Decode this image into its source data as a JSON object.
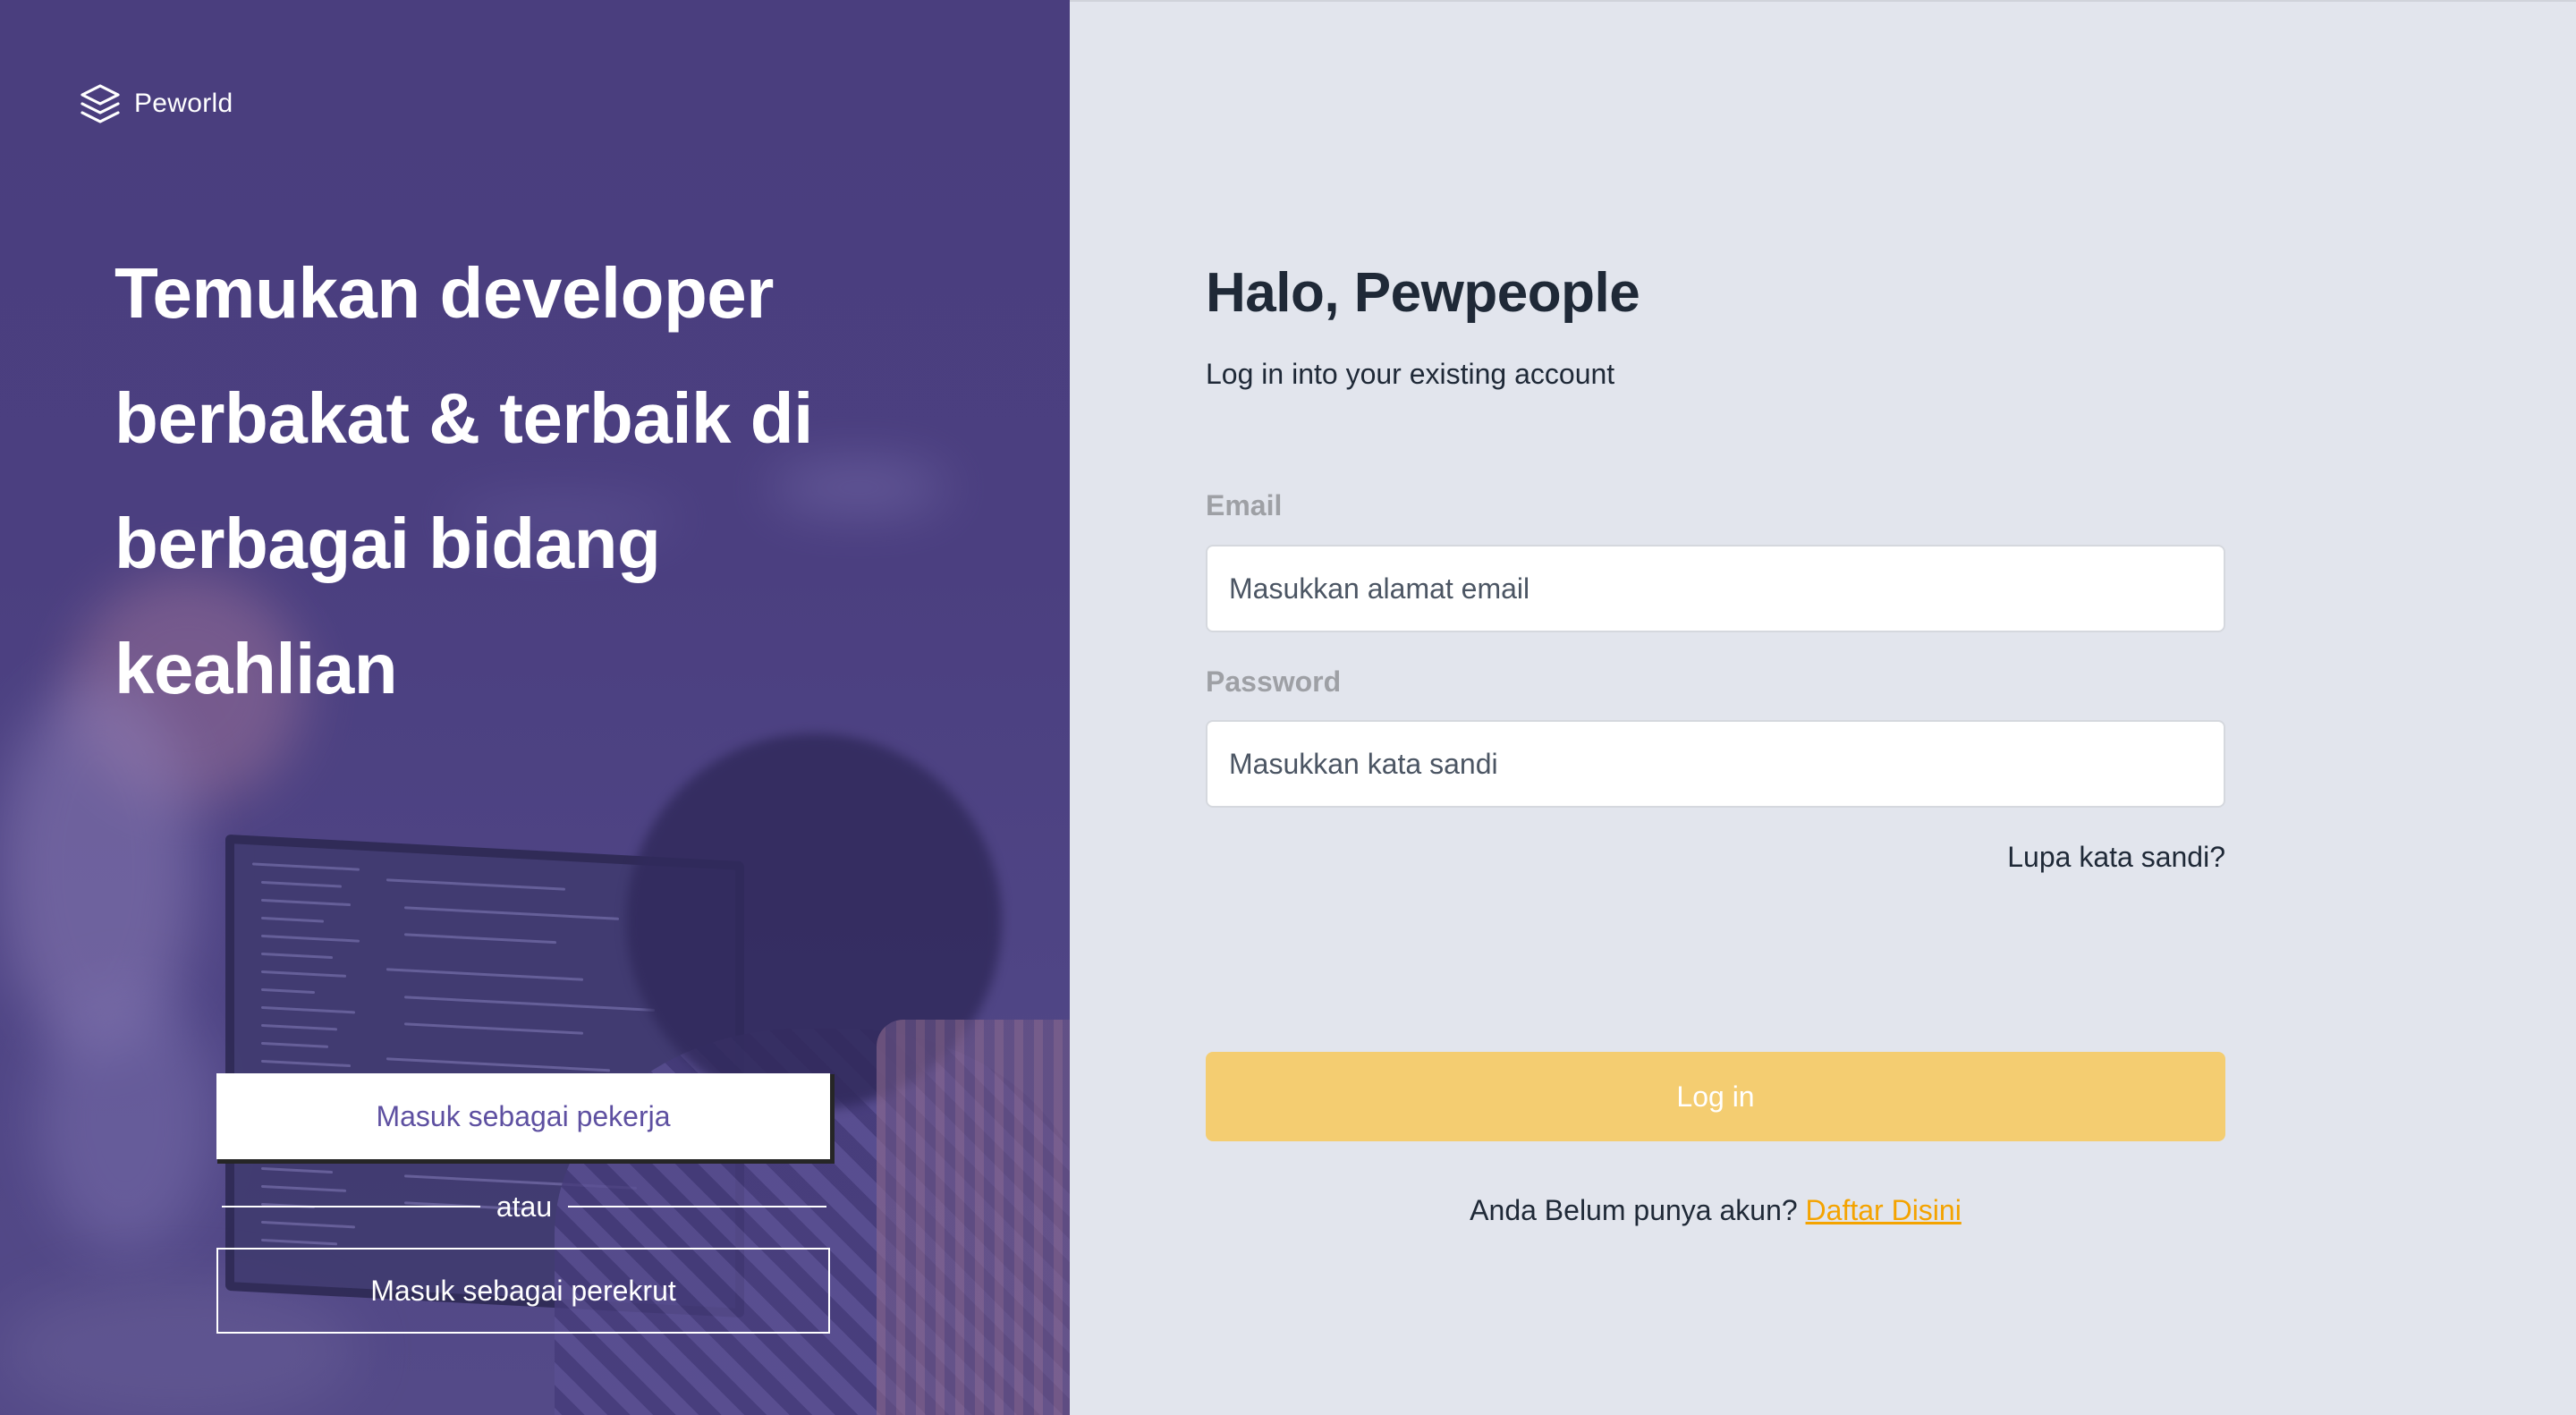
{
  "brand": {
    "name": "Peworld",
    "logo_icon": "layers-icon"
  },
  "hero": {
    "headline": "Temukan developer berbakat & terbaik di berbagai bidang keahlian",
    "worker_button": "Masuk sebagai pekerja",
    "divider_text": "atau",
    "recruiter_button": "Masuk sebagai perekrut"
  },
  "login": {
    "title": "Halo, Pewpeople",
    "subtitle": "Log in into your existing account",
    "email_label": "Email",
    "email_placeholder": "Masukkan alamat email",
    "email_value": "",
    "password_label": "Password",
    "password_placeholder": "Masukkan kata sandi",
    "password_value": "",
    "forgot_link": "Lupa kata sandi?",
    "submit_label": "Log in",
    "register_prompt": "Anda Belum punya akun?",
    "register_link": "Daftar Disini"
  },
  "colors": {
    "hero_overlay": "#4a3e7e",
    "panel_bg": "#e2e5ed",
    "accent_yellow": "#f4cd71",
    "link_orange": "#f4a300",
    "worker_text": "#5e50a1"
  }
}
